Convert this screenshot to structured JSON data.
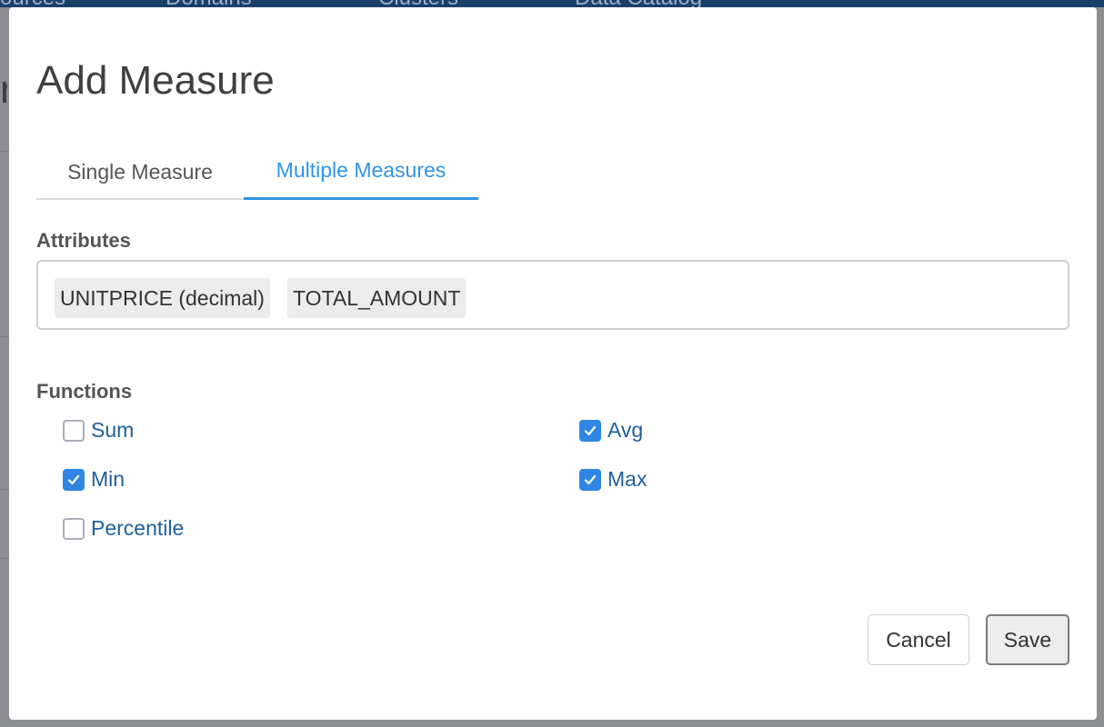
{
  "background": {
    "nav_items": [
      "ources",
      "Domains",
      "Clusters",
      "Data Catalog"
    ]
  },
  "modal": {
    "title": "Add Measure",
    "tabs": [
      {
        "label": "Single Measure",
        "active": false
      },
      {
        "label": "Multiple Measures",
        "active": true
      }
    ],
    "attributes": {
      "label": "Attributes",
      "chips": [
        "UNITPRICE (decimal)",
        "TOTAL_AMOUNT"
      ]
    },
    "functions": {
      "label": "Functions",
      "items": [
        {
          "label": "Sum",
          "checked": false
        },
        {
          "label": "Avg",
          "checked": true
        },
        {
          "label": "Min",
          "checked": true
        },
        {
          "label": "Max",
          "checked": true
        },
        {
          "label": "Percentile",
          "checked": false
        }
      ]
    },
    "buttons": {
      "cancel": "Cancel",
      "save": "Save"
    }
  },
  "colors": {
    "accent": "#2f95e4",
    "checkbox_checked": "#2f86e4",
    "function_label": "#1f5f9c",
    "nav": "#1a3f6b"
  }
}
